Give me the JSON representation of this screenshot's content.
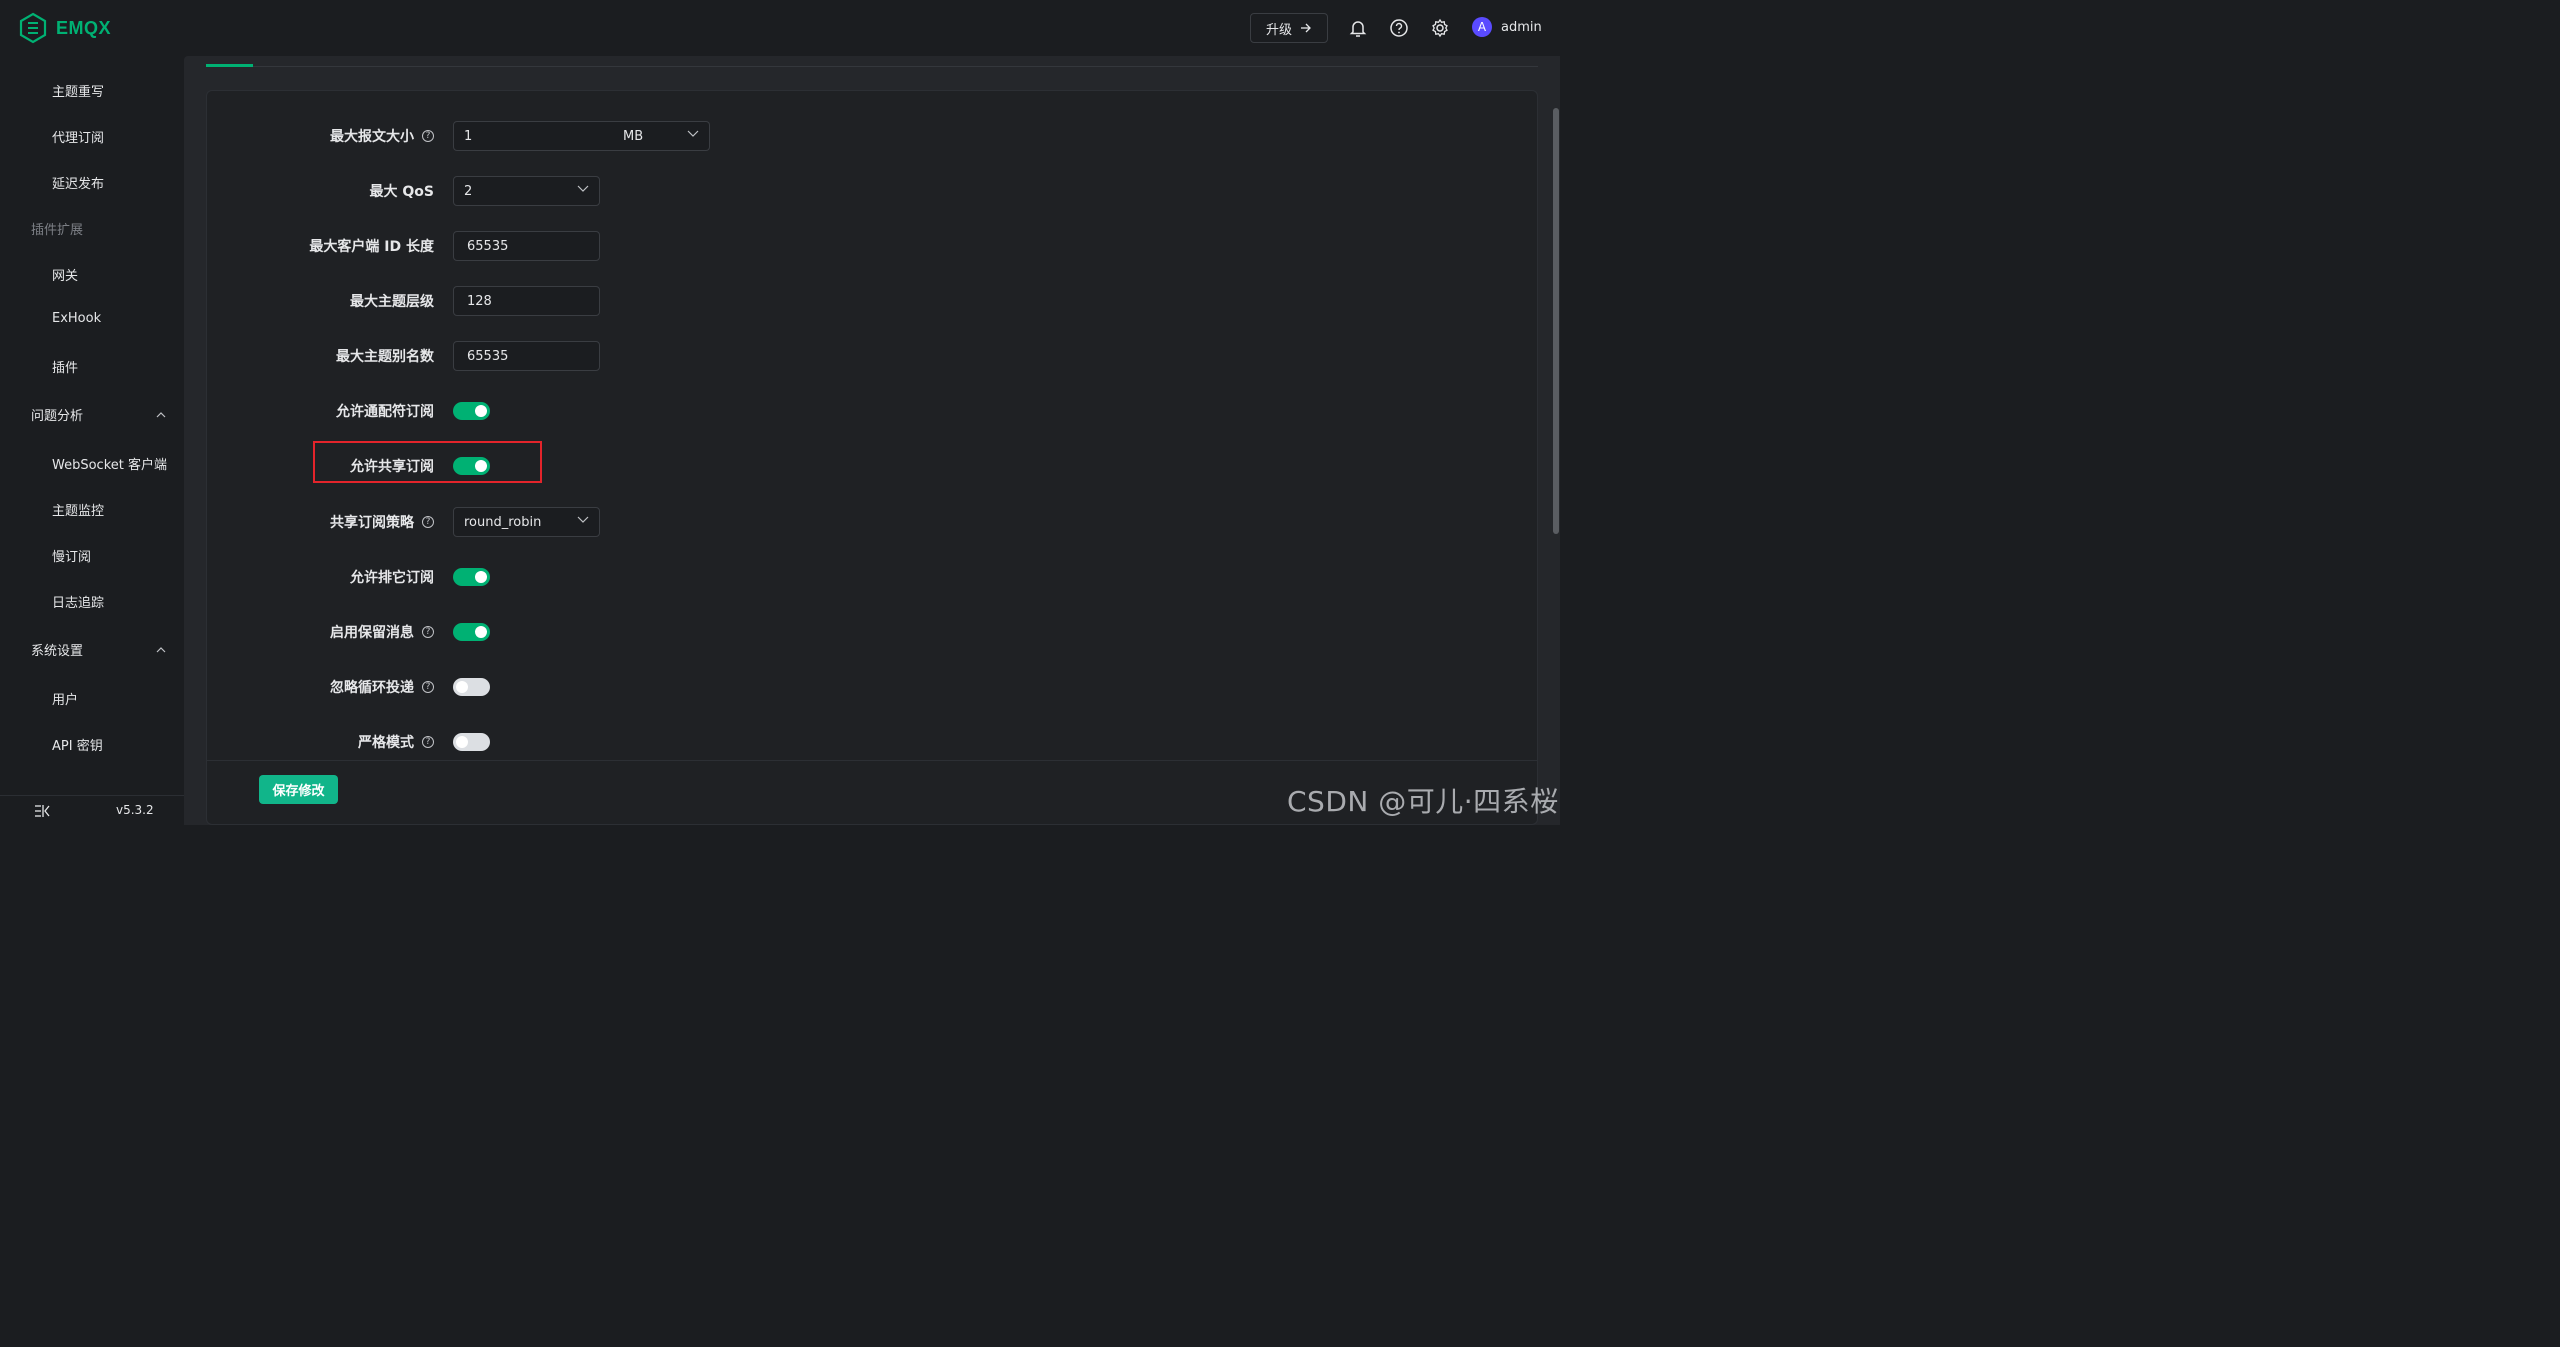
{
  "header": {
    "brand": "EMQX",
    "upgrade_label": "升级",
    "username": "admin",
    "avatar_letter": "A"
  },
  "sidebar": {
    "items_top": [
      "主题重写",
      "代理订阅",
      "延迟发布"
    ],
    "group_plugins": "插件扩展",
    "items_plugins": [
      "网关",
      "ExHook",
      "插件"
    ],
    "group_diagnose": "问题分析",
    "items_diagnose": [
      "WebSocket 客户端",
      "主题监控",
      "慢订阅",
      "日志追踪"
    ],
    "group_system": "系统设置",
    "items_system": [
      "用户",
      "API 密钥"
    ],
    "version": "v5.3.2"
  },
  "form": {
    "max_packet_size": {
      "label": "最大报文大小",
      "value": "1",
      "unit": "MB"
    },
    "max_qos": {
      "label": "最大 QoS",
      "value": "2"
    },
    "max_clientid_len": {
      "label": "最大客户端 ID 长度",
      "value": "65535"
    },
    "max_topic_levels": {
      "label": "最大主题层级",
      "value": "128"
    },
    "max_topic_alias": {
      "label": "最大主题别名数",
      "value": "65535"
    },
    "wildcard_subscription": {
      "label": "允许通配符订阅",
      "enabled": true
    },
    "shared_subscription": {
      "label": "允许共享订阅",
      "enabled": true
    },
    "shared_strategy": {
      "label": "共享订阅策略",
      "value": "round_robin"
    },
    "exclusive_subscription": {
      "label": "允许排它订阅",
      "enabled": true
    },
    "retain_available": {
      "label": "启用保留消息",
      "enabled": true
    },
    "ignore_loop_deliver": {
      "label": "忽略循环投递",
      "enabled": false
    },
    "strict_mode": {
      "label": "严格模式",
      "enabled": false
    }
  },
  "save_label": "保存修改",
  "watermark": "CSDN @可儿·四系桜",
  "colors": {
    "accent": "#00b173",
    "highlight": "#e3242b",
    "background": "#1b1d20"
  }
}
